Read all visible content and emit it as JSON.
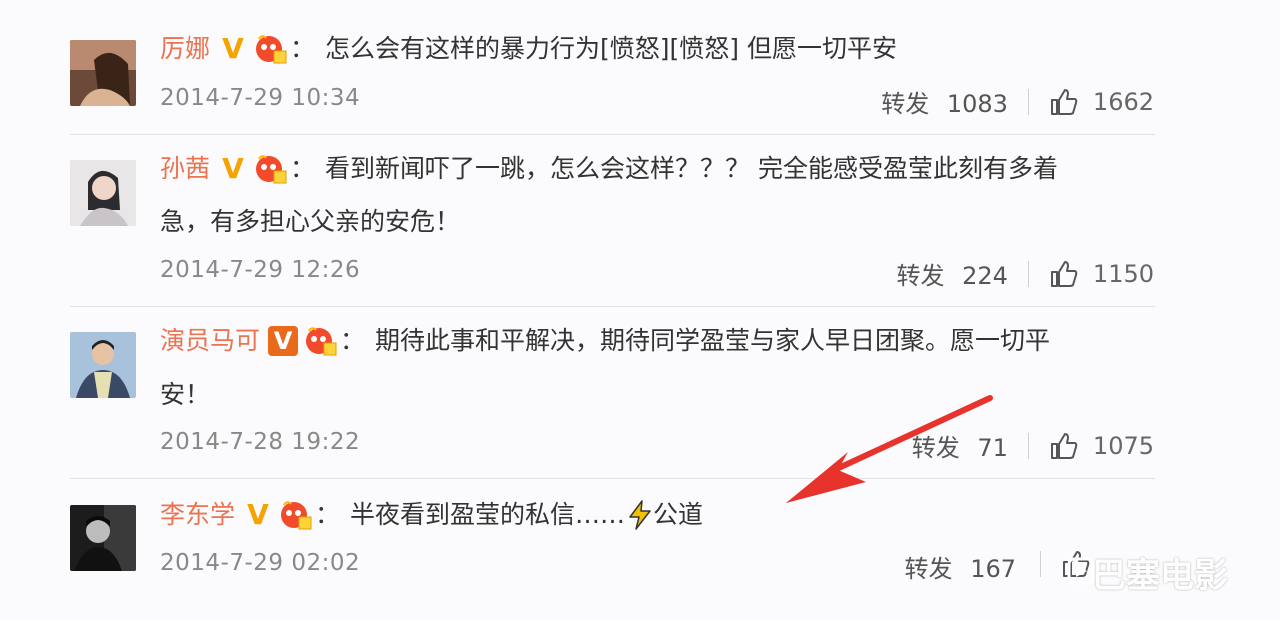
{
  "comments": [
    {
      "user": "厉娜",
      "text": "怎么会有这样的暴力行为[愤怒][愤怒] 但愿一切平安",
      "text_cont": "",
      "date": "2014-7-29 10:34",
      "repost_label": "转发",
      "reposts": "1083",
      "likes": "1662",
      "badge": "V"
    },
    {
      "user": "孙茜",
      "text": "看到新闻吓了一跳，怎么会这样？？？ 完全能感受盈莹此刻有多着",
      "text_cont": "急，有多担心父亲的安危！",
      "date": "2014-7-29 12:26",
      "repost_label": "转发",
      "reposts": "224",
      "likes": "1150",
      "badge": "V"
    },
    {
      "user": "演员马可",
      "text": "期待此事和平解决，期待同学盈莹与家人早日团聚。愿一切平",
      "text_cont": "安！",
      "date": "2014-7-28 19:22",
      "repost_label": "转发",
      "reposts": "71",
      "likes": "1075",
      "badge": "V"
    },
    {
      "user": "李东学",
      "text": "半夜看到盈莹的私信……",
      "text_suffix": "公道",
      "text_cont": "",
      "date": "2014-7-29 02:02",
      "repost_label": "转发",
      "reposts": "167",
      "likes": "",
      "badge": "V"
    }
  ],
  "colon": "：",
  "watermark": "巴塞电影",
  "colors": {
    "username": "#eb7350",
    "badge_gold": "#f5a300",
    "badge_orange": "#e86a1a",
    "arrow": "#e8322c"
  },
  "icons": [
    "avatar",
    "verified-badge-icon",
    "member-icon",
    "like-icon",
    "lightning-icon",
    "red-arrow"
  ]
}
